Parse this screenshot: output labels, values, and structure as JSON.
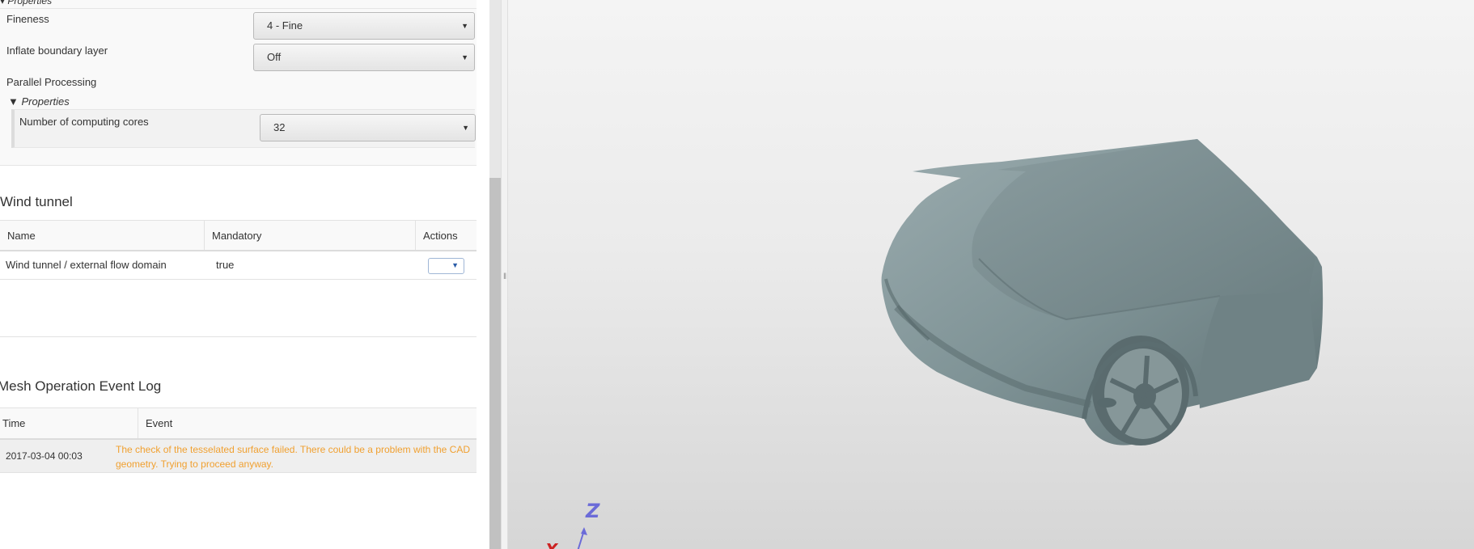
{
  "mesh_settings": {
    "properties_header": "Properties",
    "fineness_label": "Fineness",
    "fineness_value": "4 - Fine",
    "inflate_label": "Inflate boundary layer",
    "inflate_value": "Off",
    "parallel_label": "Parallel Processing",
    "parallel_properties_header": "Properties",
    "cores_label": "Number of computing cores",
    "cores_value": "32"
  },
  "wind_tunnel": {
    "title": "Wind tunnel",
    "columns": [
      "Name",
      "Mandatory",
      "Actions"
    ],
    "rows": [
      {
        "name": "Wind tunnel / external flow domain",
        "mandatory": "true"
      }
    ]
  },
  "event_log": {
    "title": "Mesh Operation Event Log",
    "columns": [
      "Time",
      "Event"
    ],
    "rows": [
      {
        "time": "2017-03-04 00:03",
        "event": "The check of the tesselated surface failed. There could be a problem with the CAD geometry. Trying to proceed anyway."
      }
    ]
  },
  "viewport": {
    "axis_z": "Z",
    "axis_x": "X",
    "colors": {
      "model": "#7f9396",
      "warning": "#f0a030",
      "axis_z": "#6b6bd8",
      "axis_x": "#cc2222"
    }
  }
}
